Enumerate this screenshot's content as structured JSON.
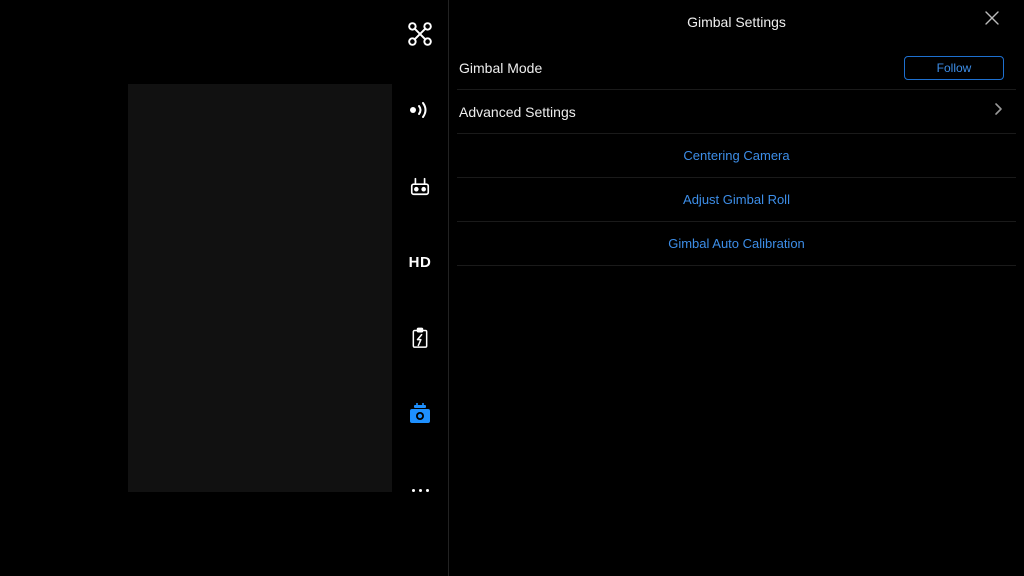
{
  "panel": {
    "title": "Gimbal Settings"
  },
  "rows": {
    "gimbal_mode": {
      "label": "Gimbal Mode",
      "value": "Follow"
    },
    "advanced": {
      "label": "Advanced Settings"
    }
  },
  "actions": {
    "centering": "Centering Camera",
    "adjust_roll": "Adjust Gimbal Roll",
    "auto_calibration": "Gimbal Auto Calibration"
  },
  "sidebar": {
    "hd_label": "HD"
  },
  "colors": {
    "accent": "#3d8ee8"
  }
}
